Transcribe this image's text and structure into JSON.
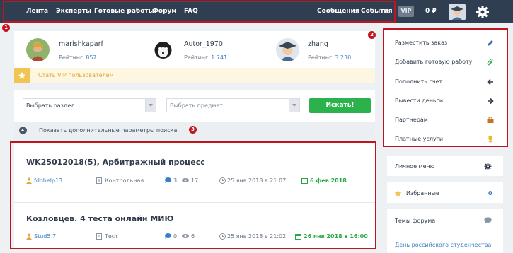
{
  "nav": {
    "items": [
      "Лента",
      "Эксперты",
      "Готовые работы",
      "Форум",
      "FAQ"
    ],
    "messages": "Сообщения",
    "events": "События",
    "vip": "VIP",
    "balance": "0 ₽"
  },
  "markers": [
    "1",
    "2",
    "3"
  ],
  "top_users": [
    {
      "name": "marishkaparf",
      "rating_label": "Рейтинг",
      "rating": "857"
    },
    {
      "name": "Autor_1970",
      "rating_label": "Рейтинг",
      "rating": "1 741"
    },
    {
      "name": "zhang",
      "rating_label": "Рейтинг",
      "rating": "3 230"
    }
  ],
  "vip_promo": "Стать VIP пользователем",
  "search": {
    "section": "Выбрать раздел",
    "subject": "Выбрать предмет",
    "button": "Искать!",
    "more": "Показать дополнительные параметры поиска"
  },
  "works": [
    {
      "title": "WK25012018(5), Арбитражный процесс",
      "author": "fdohelp13",
      "type": "Контрольная",
      "comments": "3",
      "views": "17",
      "date": "25 янв 2018 в 21:07",
      "deadline": "6 фев 2018"
    },
    {
      "title": "Козловцев. 4 теста онлайн МИЮ",
      "author": "Stud5 7",
      "type": "Тест",
      "comments": "0",
      "views": "6",
      "date": "25 янв 2018 в 21:02",
      "deadline": "26 янв 2018 в 16:00"
    }
  ],
  "sidebar": {
    "actions": [
      "Разместить заказ",
      "Добавить готовую работу",
      "Пополнить счет",
      "Вывести деньги",
      "Партнерам",
      "Платные услуги"
    ],
    "personal_menu": "Личное меню",
    "favorites": "Избранные",
    "favorites_count": "0",
    "forum_topics": "Темы форума",
    "forum_link": "День российского студенчества"
  },
  "colors": {
    "topbar": "#2f3e50",
    "accent_red": "#c0141f",
    "green": "#2bb24c",
    "link": "#3a7fc1"
  }
}
